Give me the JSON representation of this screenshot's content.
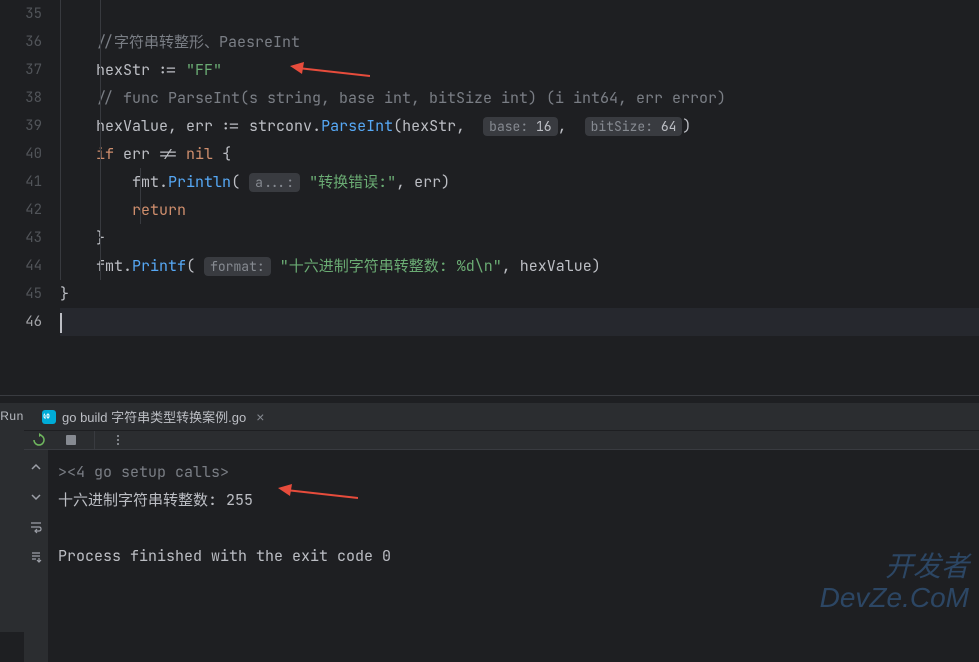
{
  "lines": {
    "35": "35",
    "36": "36",
    "37": "37",
    "38": "38",
    "39": "39",
    "40": "40",
    "41": "41",
    "42": "42",
    "43": "43",
    "44": "44",
    "45": "45",
    "46": "46"
  },
  "code": {
    "l36_comment": "//字符串转整形、PaesreInt",
    "l37_var": "hexStr",
    "l37_op": " := ",
    "l37_val": "\"FF\"",
    "l38_comment": "// func ParseInt(s string, base int, bitSize int) (i int64, err error)",
    "l39_vars": "hexValue, err",
    "l39_op": " := ",
    "l39_call_pkg": "strconv",
    "l39_call_fn": "ParseInt",
    "l39_arg1": "hexStr",
    "l39_hint1_label": "base:",
    "l39_hint1_val": " 16",
    "l39_hint2_label": "bitSize:",
    "l39_hint2_val": " 64",
    "l40_if": "if",
    "l40_cond": " err != ",
    "l40_nil": "nil",
    "l40_brace": " {",
    "l41_pkg": "fmt",
    "l41_fn": "Println",
    "l41_hint_label": "a...:",
    "l41_str": "\"转换错误:\"",
    "l41_arg": ", err)",
    "l42_return": "return",
    "l43_brace": "}",
    "l44_pkg": "fmt",
    "l44_fn": "Printf",
    "l44_hint_label": "format:",
    "l44_str": "\"十六进制字符串转整数: %d\\n\"",
    "l44_arg": ", hexValue)",
    "l45_brace": "}"
  },
  "panel": {
    "run_label": "Run",
    "tab_name": "go build 字符串类型转换案例.go"
  },
  "console": {
    "fold_prefix": ">",
    "fold_text": "<4 go setup calls>",
    "output_line": "十六进制字符串转整数: 255",
    "exit_line": "Process finished with the exit code 0"
  },
  "watermark": {
    "line1": "开发者",
    "line2": "DevZe.CoM"
  }
}
